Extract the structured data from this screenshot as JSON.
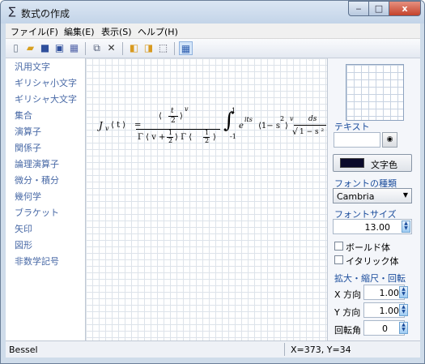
{
  "window": {
    "title": "数式の作成",
    "icon": "∑",
    "min": "‒",
    "max": "□",
    "close": "x"
  },
  "menu": [
    "ファイル(F)",
    "編集(E)",
    "表示(S)",
    "ヘルプ(H)"
  ],
  "toolbar_icons": [
    "new-file-icon",
    "open-folder-icon",
    "save-icon",
    "save-as-icon",
    "image-icon",
    "copy-icon",
    "delete-icon",
    "bring-forward-icon",
    "send-backward-icon",
    "select-rect-icon",
    "grid-icon"
  ],
  "sidebar": {
    "items": [
      "汎用文字",
      "ギリシャ小文字",
      "ギリシャ大文字",
      "集合",
      "演算子",
      "関係子",
      "論理演算子",
      "微分・積分",
      "幾何学",
      "ブラケット",
      "矢印",
      "図形",
      "非数学記号"
    ]
  },
  "formula": {
    "lhs": "J",
    "lhs_sub": "v",
    "lhs_arg": "⟨ t ⟩",
    "eq": "=",
    "num_paren": "⟨",
    "num_t": "t",
    "num_2": "2",
    "num_paren_r": "⟩",
    "num_sup": "v",
    "den": "Γ ⟨ v +",
    "den_half_n": "1",
    "den_half_d": "2",
    "den_mid": "⟩ Γ ⟨",
    "den_half2_n": "1",
    "den_half2_d": "2",
    "den_end": "⟩",
    "int": "∫",
    "int_hi": "1",
    "int_lo": "-1",
    "exp_base": "e",
    "exp": "its",
    "bracket": "⟨1− s",
    "bracket_sup": "2",
    "bracket_end": "⟩",
    "bracket_pow": "v",
    "frac_num": "ds",
    "sqrt": "√",
    "frac_den": "1 − s ²"
  },
  "panel": {
    "text_label": "テキスト",
    "text_value": "",
    "text_button_icon": "preview-icon",
    "color_button_label": "文字色",
    "text_color": "#0a0a2a",
    "font_type_label": "フォントの種類",
    "font_value": "Cambria",
    "font_size_label": "フォントサイズ",
    "font_size": "13.00",
    "bold_label": "ボールド体",
    "italic_label": "イタリック体",
    "transform_label": "拡大・縮尺・回転",
    "x_label": "X 方向",
    "x_value": "1.00",
    "y_label": "Y 方向",
    "y_value": "1.00",
    "rot_label": "回転角",
    "rot_value": "0"
  },
  "status": {
    "left": "Bessel",
    "right": "X=373, Y=34"
  }
}
